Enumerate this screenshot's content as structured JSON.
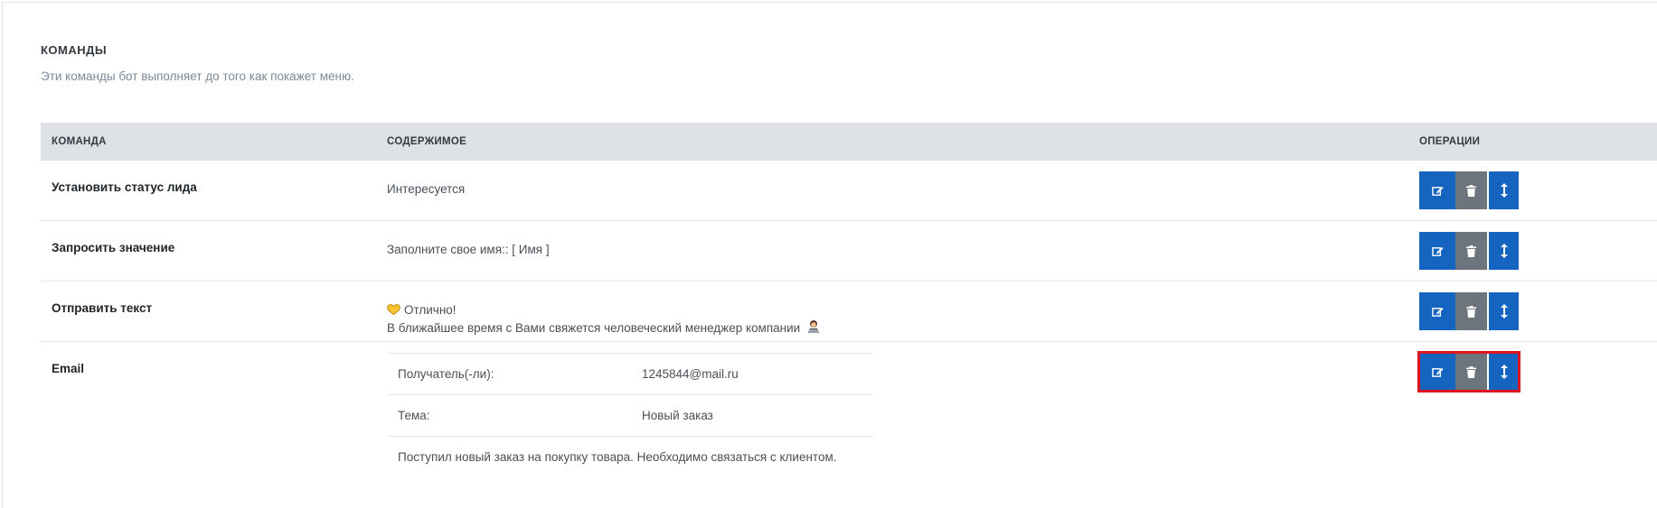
{
  "section": {
    "title": "КОМАНДЫ",
    "subtitle": "Эти команды бот выполняет до того как покажет меню."
  },
  "table": {
    "headers": {
      "command": "КОМАНДА",
      "content": "СОДЕРЖИМОЕ",
      "operations": "ОПЕРАЦИИ"
    },
    "rows": [
      {
        "command": "Установить статус лида",
        "content": "Интересуется"
      },
      {
        "command": "Запросить значение",
        "content": "Заполните свое имя:: [ Имя ]"
      },
      {
        "command": "Отправить текст",
        "content_line1": "Отлично!",
        "content_line2": "В ближайшее время с Вами свяжется человеческий менеджер компании",
        "emoji1": "yellow-heart-icon",
        "emoji2": "person-at-laptop-icon"
      },
      {
        "command": "Email",
        "email": {
          "recipient_label": "Получатель(-ли):",
          "recipient_value": "1245844@mail.ru",
          "subject_label": "Тема:",
          "subject_value": "Новый заказ",
          "body": "Поступил новый заказ на покупку товара. Необходимо связаться с клиентом."
        }
      }
    ]
  },
  "icons": {
    "edit": "edit-icon",
    "delete": "trash-icon",
    "move": "drag-vertical-icon"
  },
  "colors": {
    "primary": "#1565c0",
    "secondary": "#6c757d",
    "highlight": "#e0141e",
    "header_bg": "#dee2e6"
  }
}
